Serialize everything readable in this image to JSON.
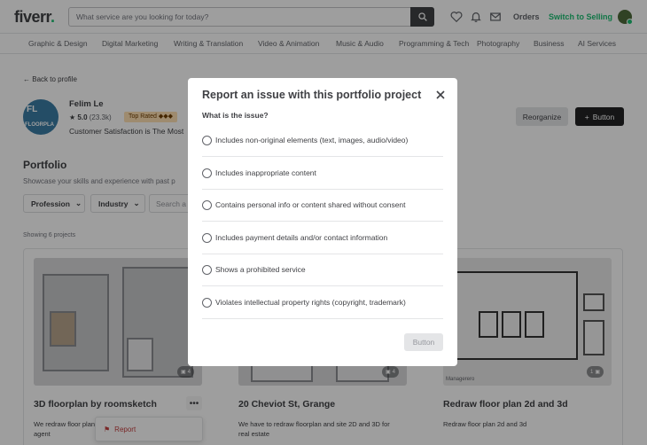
{
  "header": {
    "logo": "fiverr",
    "logo_dot": ".",
    "search_placeholder": "What service are you looking for today?",
    "orders": "Orders",
    "switch": "Switch to Selling",
    "icons": [
      "search-icon",
      "heart-icon",
      "bell-icon",
      "mail-icon",
      "avatar"
    ]
  },
  "categories": [
    "Graphic & Design",
    "Digital Marketing",
    "Writing & Translation",
    "Video & Animation",
    "Music & Audio",
    "Programming & Tech",
    "Photography",
    "Business",
    "AI Services"
  ],
  "profile": {
    "back": "Back to profile",
    "pic_line1": "FL",
    "pic_line2": "FLOORPLA",
    "name": "Felim Le",
    "rating": "5.0",
    "reviews": "(23.3k)",
    "badge": "Top Rated ◆◆◆",
    "description": "Customer Satisfaction is The Most",
    "reorganize": "Reorganize",
    "button": "Button"
  },
  "portfolio": {
    "heading": "Portfolio",
    "subheading": "Showcase your skills and experience with past p",
    "filter_profession": "Profession",
    "filter_industry": "Industry",
    "search": "Search a",
    "showing": "Showing 6 projects"
  },
  "cards": [
    {
      "title": "3D floorplan by roomsketch",
      "desc_line1": "We redraw floor plan",
      "desc_line2": "agent",
      "badge": "4"
    },
    {
      "title": "20 Cheviot St, Grange",
      "desc_line1": "We have to redraw floorplan and site 2D and 3D for",
      "desc_line2": "real estate",
      "badge": "4"
    },
    {
      "title": "Redraw floor plan 2d and 3d",
      "desc_line1": "Redraw floor plan 2d and 3d",
      "desc_line2": "",
      "badge": "1",
      "watermark": "Managerero"
    }
  ],
  "card_menu": {
    "dots": "•••",
    "report": "Report"
  },
  "modal": {
    "title": "Report an issue with this portfolio project",
    "question": "What is the issue?",
    "options": [
      "Includes non-original elements (text, images, audio/video)",
      "Includes inappropriate content",
      "Contains personal info or content shared without consent",
      "Includes payment details and/or contact information",
      "Shows a prohibited service",
      "Violates intellectual property rights (copyright, trademark)"
    ],
    "button": "Button"
  },
  "colors": {
    "brand_green": "#1dbf73",
    "text": "#404145",
    "dark_button": "#222325",
    "report_red": "#c43e3e"
  }
}
